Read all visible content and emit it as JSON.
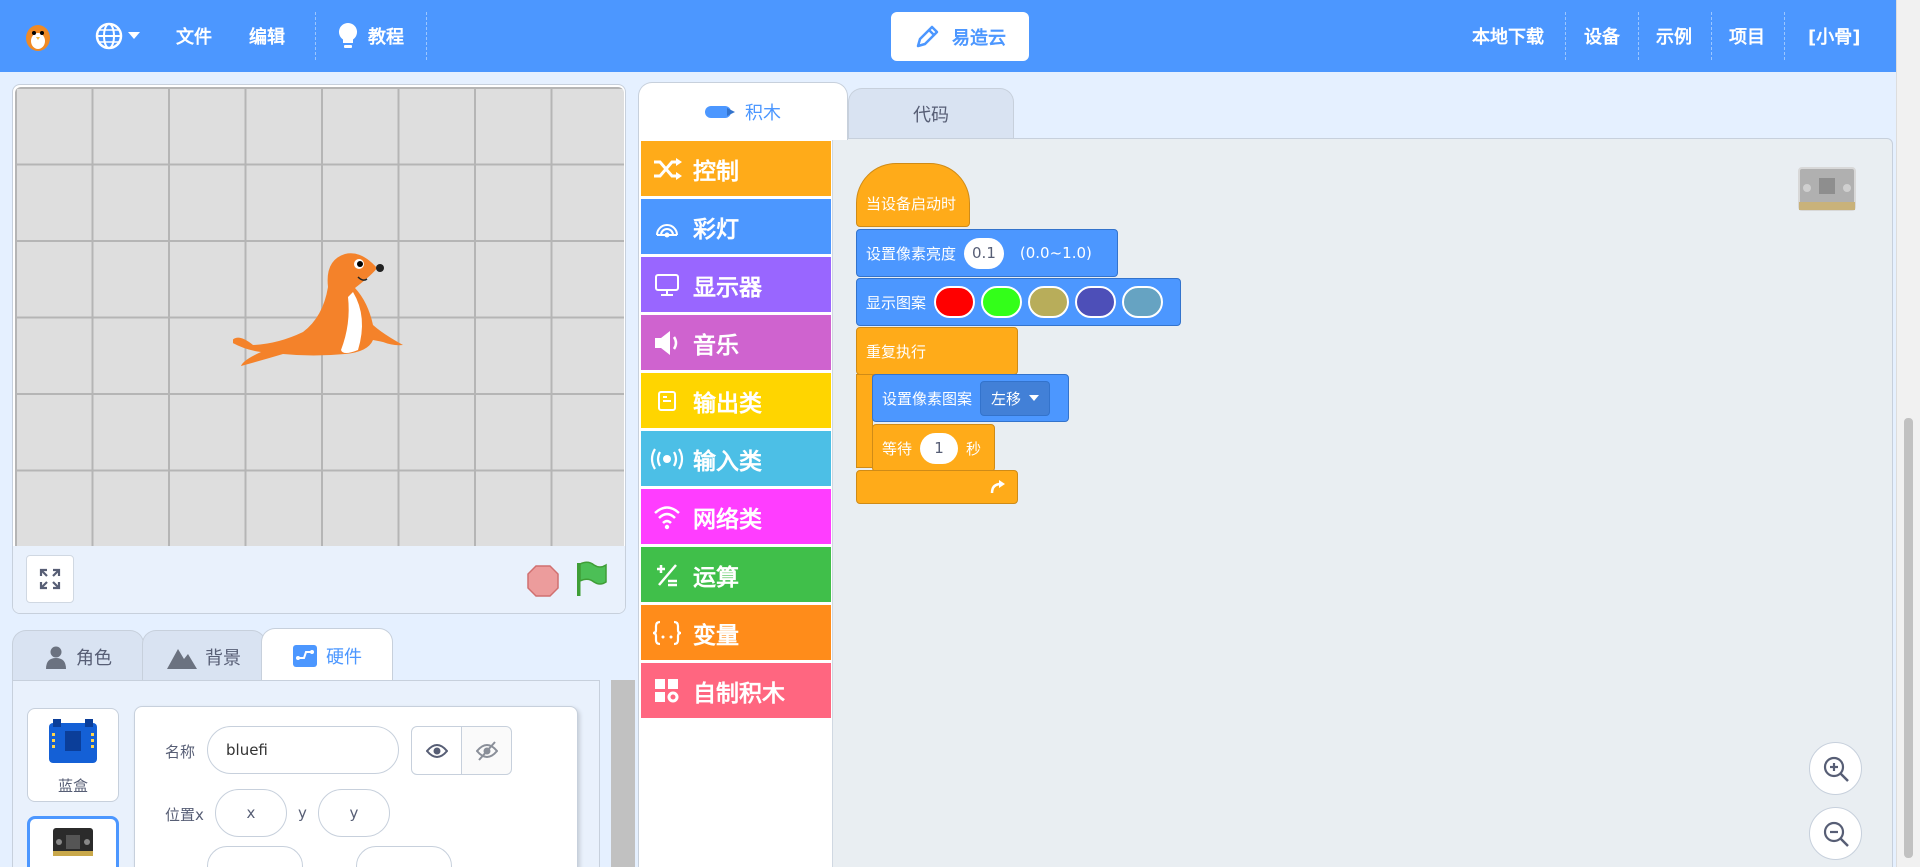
{
  "topbar": {
    "menu_file": "文件",
    "menu_edit": "编辑",
    "menu_tutorial": "教程",
    "cloud_button": "易造云",
    "right_menu": [
      "本地下载",
      "设备",
      "示例",
      "项目",
      "[小骨]"
    ]
  },
  "stage": {
    "sprite_icon": "seal-sprite"
  },
  "sprite_tabs": [
    "角色",
    "背景",
    "硬件"
  ],
  "sprite_list": [
    {
      "label": "蓝盒",
      "icon": "bluefi-board-icon"
    },
    {
      "label": "",
      "icon": "microbit-board-icon"
    }
  ],
  "info": {
    "name_label": "名称",
    "name_value": "bluefi",
    "pos_x_label": "位置x",
    "x_placeholder": "x",
    "y_label": "y",
    "y_placeholder": "y"
  },
  "editor_tabs": {
    "blocks": "积木",
    "code": "代码"
  },
  "categories": [
    {
      "label": "控制",
      "color": "#ffab19",
      "icon": "shuffle-icon"
    },
    {
      "label": "彩灯",
      "color": "#4c97ff",
      "icon": "rainbow-light-icon"
    },
    {
      "label": "显示器",
      "color": "#9966ff",
      "icon": "monitor-icon"
    },
    {
      "label": "音乐",
      "color": "#cf63cf",
      "icon": "speaker-icon"
    },
    {
      "label": "输出类",
      "color": "#ffd500",
      "icon": "output-icon"
    },
    {
      "label": "输入类",
      "color": "#4cbfe6",
      "icon": "broadcast-icon"
    },
    {
      "label": "网络类",
      "color": "#ff3dff",
      "icon": "wifi-icon"
    },
    {
      "label": "运算",
      "color": "#40bf4a",
      "icon": "operators-icon"
    },
    {
      "label": "变量",
      "color": "#ff8c1a",
      "icon": "braces-icon"
    },
    {
      "label": "自制积木",
      "color": "#ff6680",
      "icon": "custom-blocks-icon"
    }
  ],
  "script": {
    "hat": "当设备启动时",
    "brightness_label": "设置像素亮度",
    "brightness_value": "0.1",
    "brightness_range": "(0.0~1.0)",
    "show_pattern_label": "显示图案",
    "pattern_colors": [
      "#ff0000",
      "#33ff19",
      "#b8ad5a",
      "#4d4fb8",
      "#66a3c2"
    ],
    "repeat_label": "重复执行",
    "set_pattern_label": "设置像素图案",
    "set_pattern_option": "左移",
    "wait_label": "等待",
    "wait_value": "1",
    "wait_unit": "秒"
  }
}
